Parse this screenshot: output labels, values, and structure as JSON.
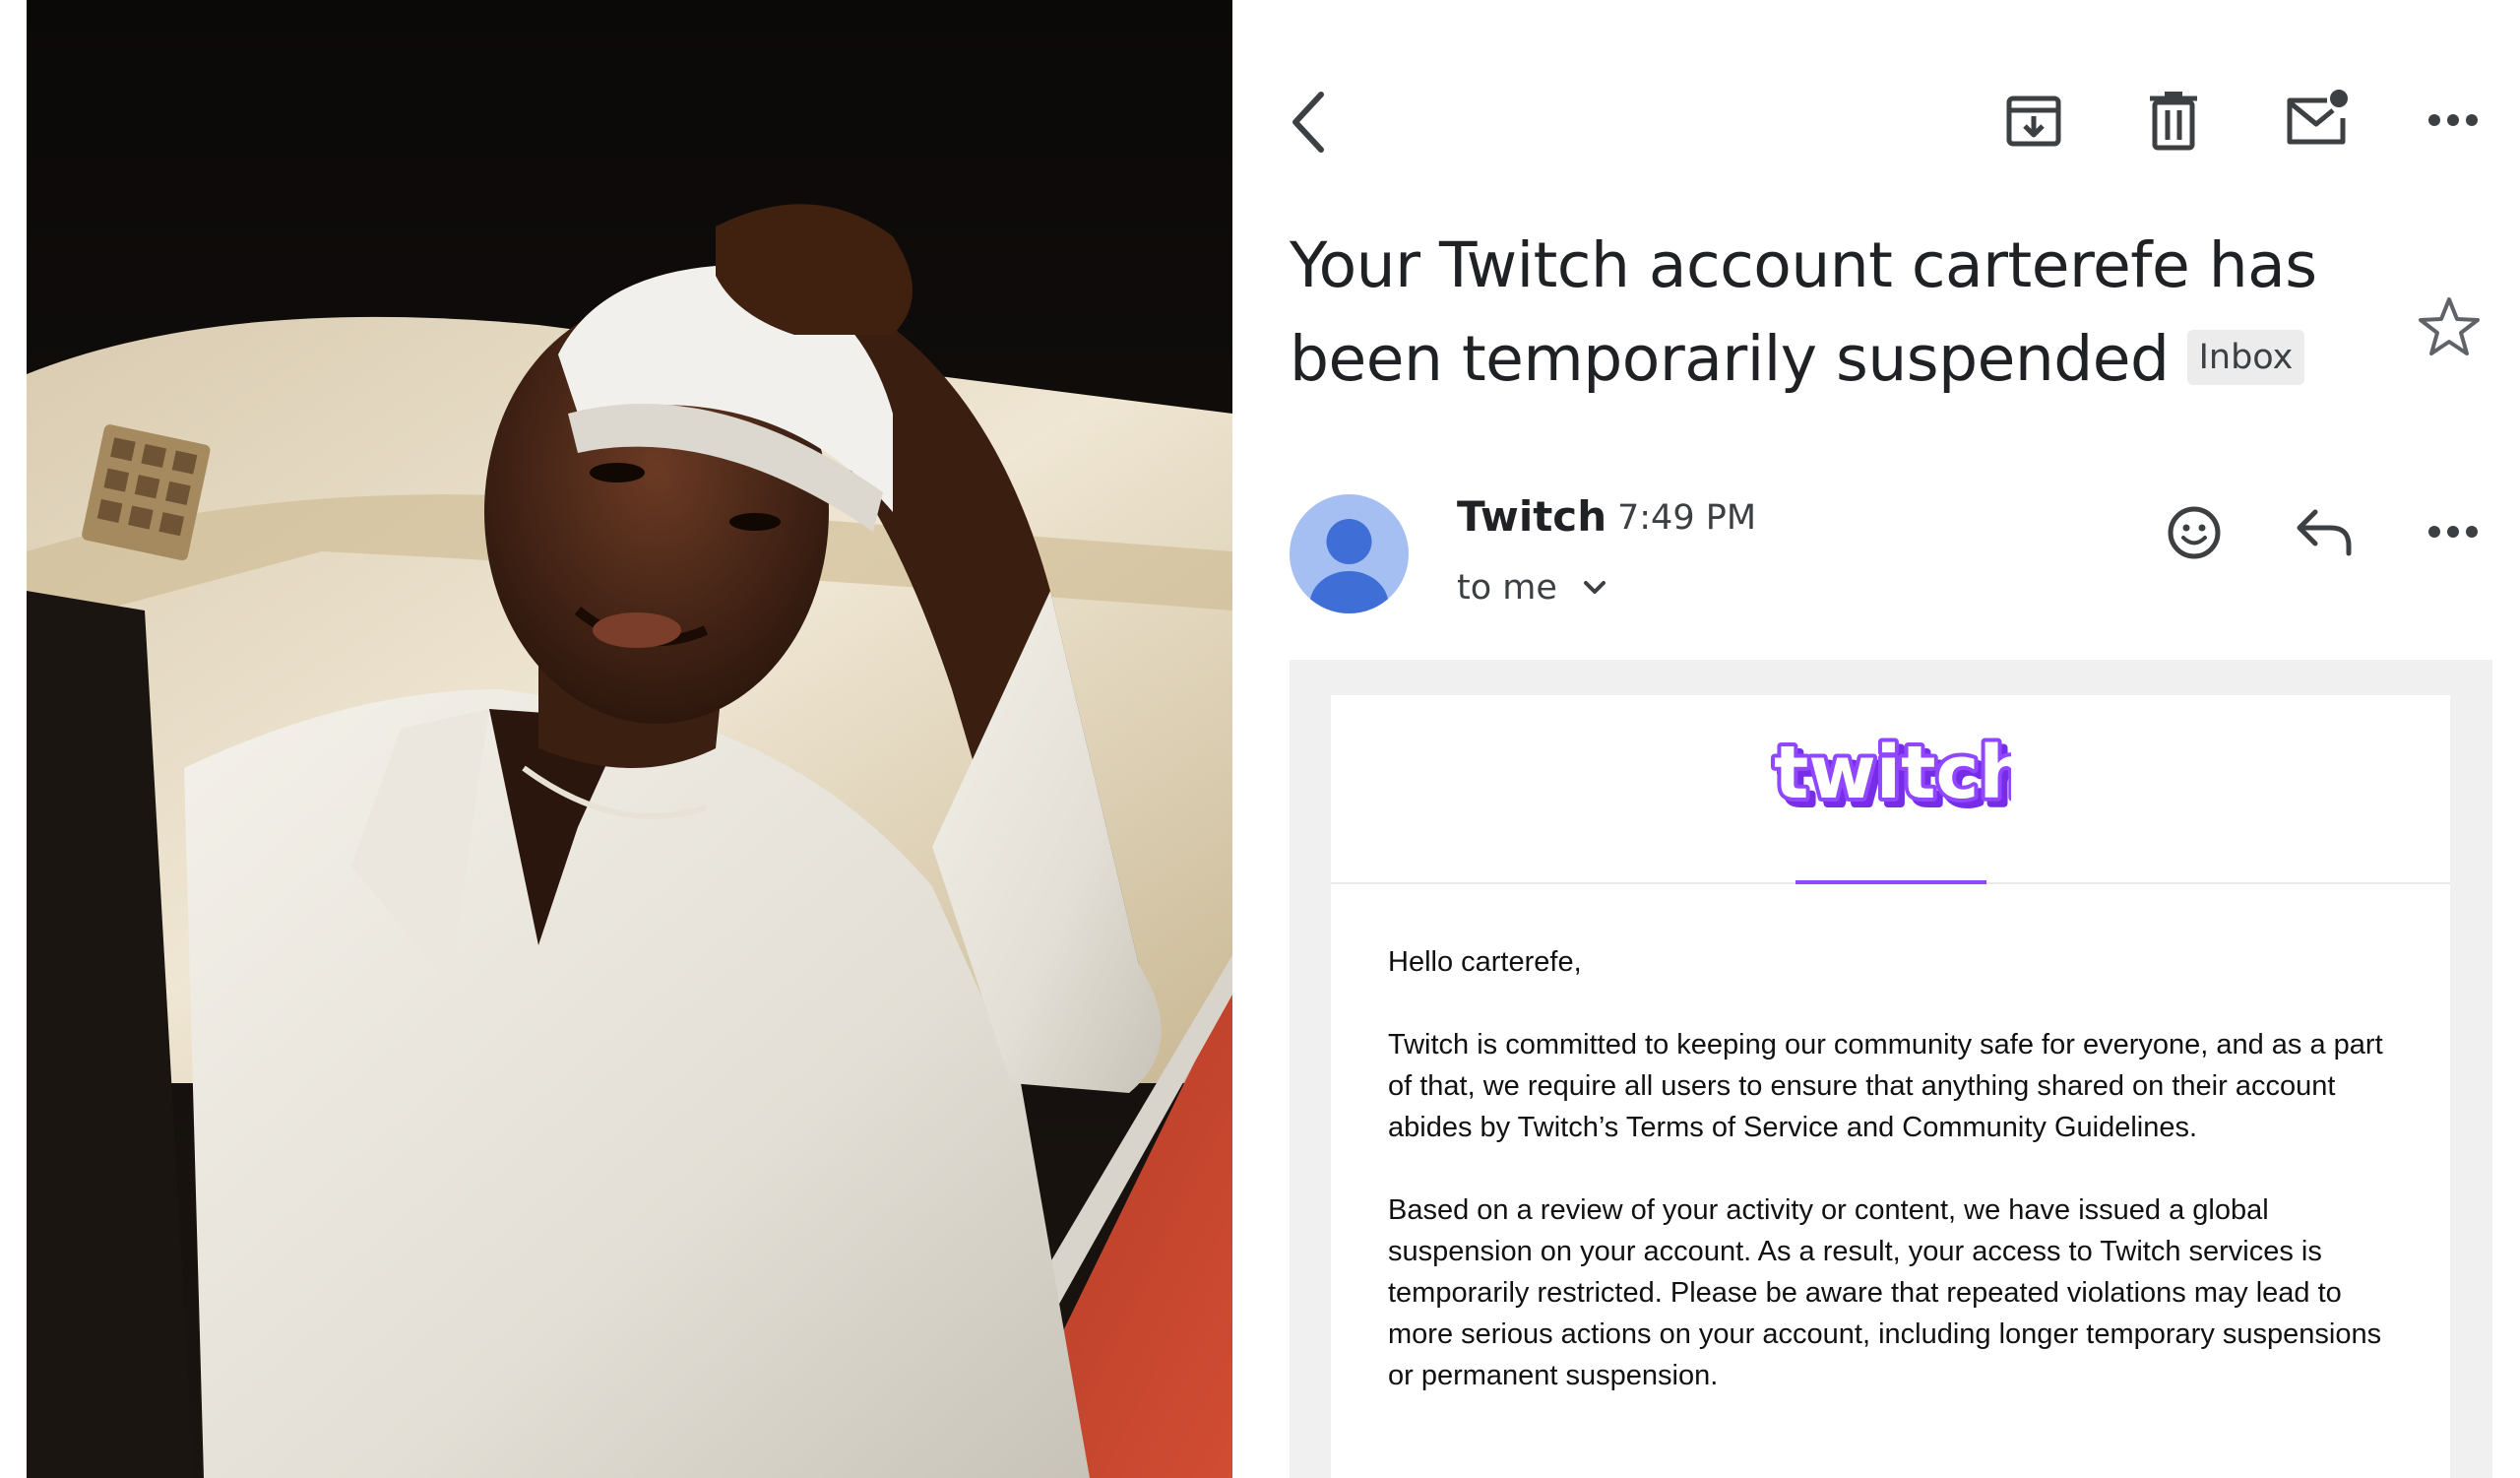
{
  "photo": {
    "alt": "Portrait photo"
  },
  "toolbar": {
    "back_icon": "back-arrow-icon",
    "archive_icon": "archive-icon",
    "delete_icon": "trash-icon",
    "mark_unread_icon": "mark-unread-icon",
    "more_icon": "more-icon"
  },
  "email": {
    "subject": "Your Twitch account carterefe has been temporarily suspended",
    "label": "Inbox",
    "sender": "Twitch",
    "time": "7:49 PM",
    "recipient": "to me",
    "greeting": "Hello carterefe,",
    "paragraphs": [
      "Twitch is committed to keeping our community safe for everyone, and as a part of that, we require all users to ensure that anything shared on their account abides by Twitch’s Terms of Service and Community Guidelines.",
      "Based on a review of your activity or content, we have issued a global suspension on your account. As a result, your access to Twitch services is temporarily restricted. Please be aware that repeated violations may lead to more serious actions on your account, including longer temporary suspensions or permanent suspension."
    ],
    "logo_text": "twitch"
  },
  "colors": {
    "twitch_purple": "#9146ff",
    "avatar_bg": "#a6bff2",
    "avatar_fg": "#3f6fd6"
  }
}
